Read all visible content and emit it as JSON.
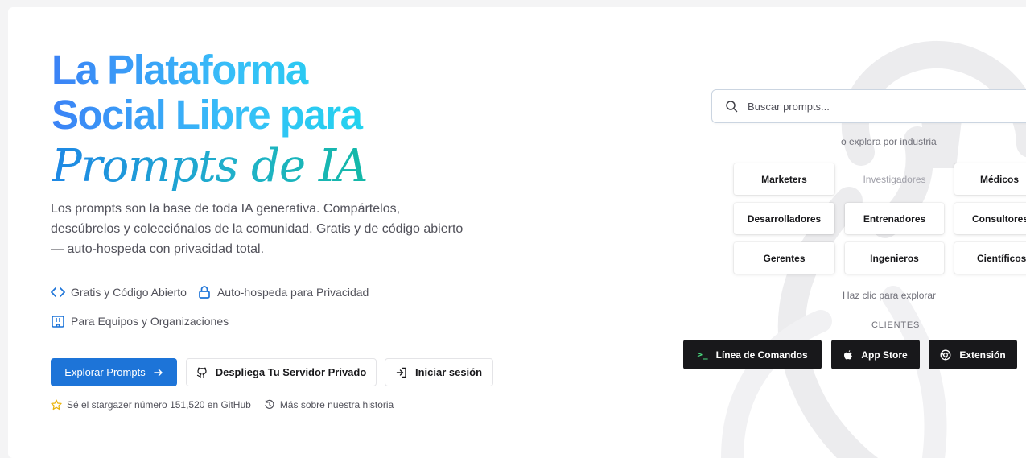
{
  "hero": {
    "title_line1": "La Plataforma",
    "title_line2": "Social Libre para",
    "title_line3": "Prompts de IA",
    "description": "Los prompts son la base de toda IA generativa. Compártelos, descúbrelos y colecciónalos de la comunidad. Gratis y de código abierto — auto-hospeda con privacidad total."
  },
  "features": {
    "open_source": "Gratis y Código Abierto",
    "self_host": "Auto-hospeda para Privacidad",
    "teams": "Para Equipos y Organizaciones"
  },
  "buttons": {
    "explore": "Explorar Prompts",
    "deploy": "Despliega Tu Servidor Privado",
    "login": "Iniciar sesión"
  },
  "meta": {
    "stargazer": "Sé el stargazer número 151,520 en GitHub",
    "history": "Más sobre nuestra historia"
  },
  "search": {
    "placeholder": "Buscar prompts..."
  },
  "industry": {
    "prompt": "o explora por industria",
    "items": [
      "Marketers",
      "Investigadores",
      "Médicos",
      "Desarrolladores",
      "Entrenadores",
      "Consultores",
      "Gerentes",
      "Ingenieros",
      "Científicos"
    ],
    "hint": "Haz clic para explorar"
  },
  "clients": {
    "heading": "CLIENTES",
    "cli": "Línea de Comandos",
    "appstore": "App Store",
    "extension": "Extensión"
  },
  "colors": {
    "primary": "#1d74d8",
    "gradient_start": "#3b82f6",
    "gradient_end": "#14b8a6",
    "dark_button": "#18181b",
    "star": "#eab308"
  }
}
